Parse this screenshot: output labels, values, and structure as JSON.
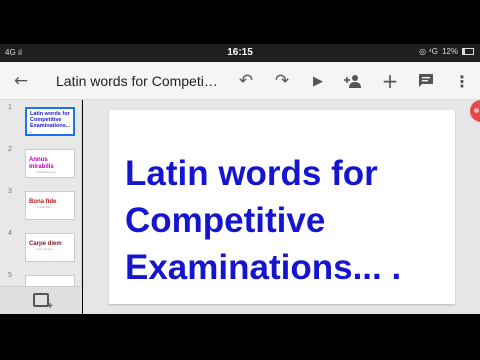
{
  "statusbar": {
    "network": "4G ıl",
    "time": "16:15",
    "battery": "12%",
    "extra": "◎ ⁴G"
  },
  "toolbar": {
    "title": "Latin words for Competi…",
    "icons": [
      "back-arrow-icon",
      "undo-icon",
      "redo-icon",
      "play-icon",
      "add-person-icon",
      "add-icon",
      "comment-icon",
      "more-vert-icon"
    ]
  },
  "sidebar": {
    "slides": [
      {
        "num": "1",
        "line1": "Latin words for",
        "line2": "Competitive",
        "line3": "Examinations...  .",
        "color": "#1515d0"
      },
      {
        "num": "2",
        "title": "Annus mirabilis",
        "subtitle": "(remarkable year)",
        "color": "#b000b0"
      },
      {
        "num": "3",
        "title": "Bona fide",
        "subtitle": "(in good faith)",
        "color": "#d01010"
      },
      {
        "num": "4",
        "title": "Carpe diem",
        "subtitle": "(seize the day)",
        "color": "#7a1a1a"
      },
      {
        "num": "5"
      }
    ]
  },
  "slide": {
    "text": "Latin words for\nCompetitive\nExaminations... ."
  }
}
